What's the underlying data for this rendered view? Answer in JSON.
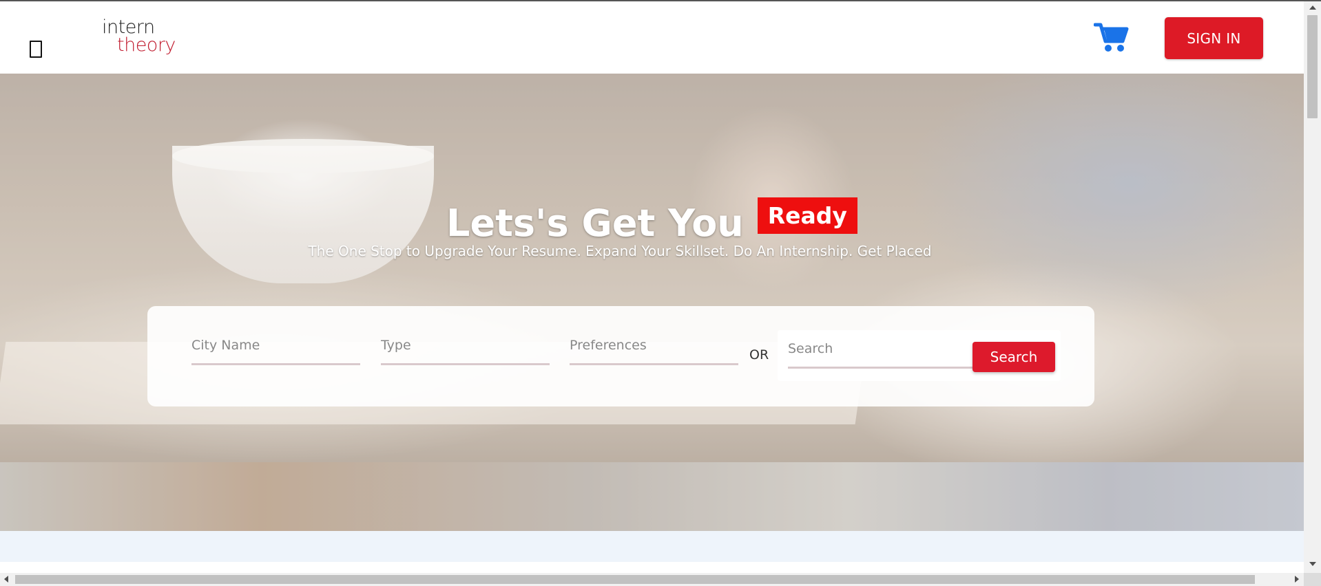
{
  "colors": {
    "brand_red": "#dd1a26",
    "badge_red": "#ee0f0f",
    "cart_blue": "#1a73e8"
  },
  "header": {
    "menu_icon": "hamburger-icon",
    "logo": {
      "line1": "intern",
      "line2": "theory"
    },
    "cart_icon": "shopping-cart-icon",
    "signin_label": "SIGN IN"
  },
  "hero": {
    "title": "Lets's Get You",
    "badge": "Ready",
    "subtitle": "The One Stop to Upgrade Your Resume. Expand Your Skillset. Do An Internship. Get Placed"
  },
  "search": {
    "city_placeholder": "City Name",
    "type_placeholder": "Type",
    "preferences_placeholder": "Preferences",
    "or_label": "OR",
    "search_placeholder": "Search",
    "search_button": "Search"
  }
}
